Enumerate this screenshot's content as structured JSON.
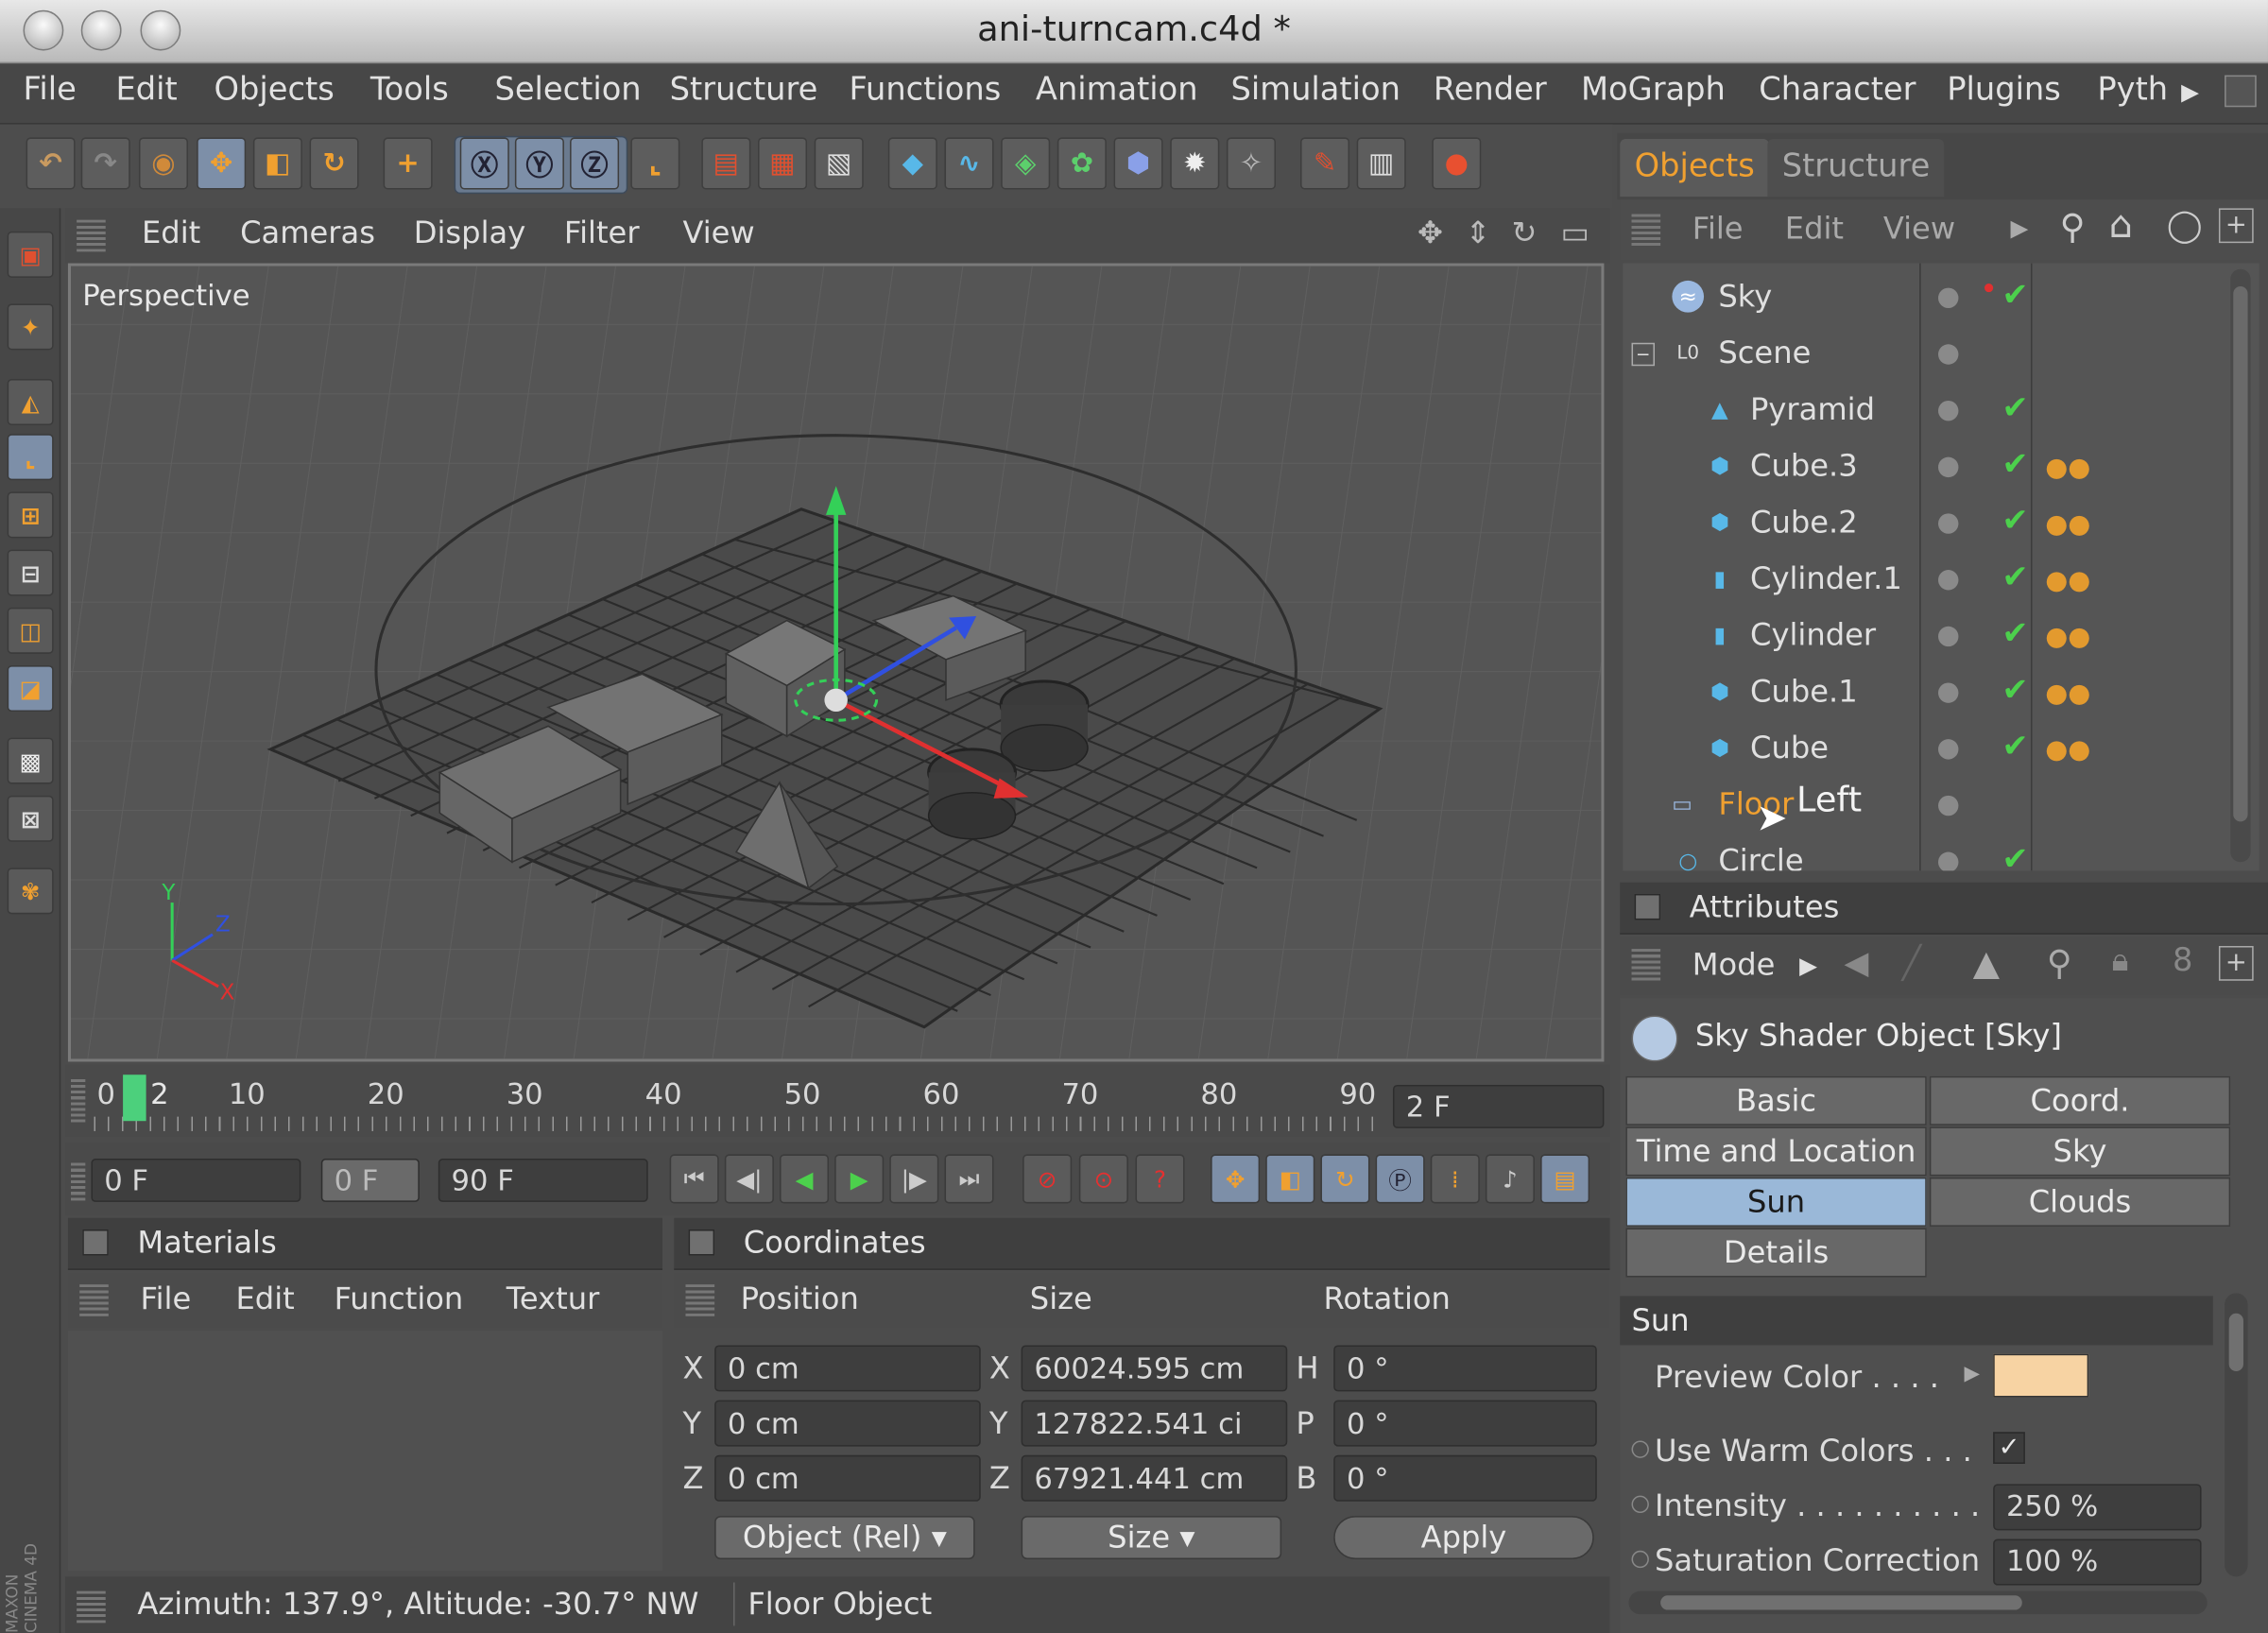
{
  "window": {
    "title": "ani-turncam.c4d *"
  },
  "menubar": {
    "items": [
      "File",
      "Edit",
      "Objects",
      "Tools",
      "Selection",
      "Structure",
      "Functions",
      "Animation",
      "Simulation",
      "Render",
      "MoGraph",
      "Character",
      "Plugins",
      "Pyth"
    ]
  },
  "viewport": {
    "menu": [
      "Edit",
      "Cameras",
      "Display",
      "Filter",
      "View"
    ],
    "label": "Perspective",
    "axis": {
      "y": "Y",
      "z": "Z",
      "x": "X"
    }
  },
  "timeline": {
    "ticks": [
      "0",
      "10",
      "20",
      "30",
      "40",
      "50",
      "60",
      "70",
      "80",
      "90"
    ],
    "current_marker": "2",
    "frame_field": "2 F"
  },
  "transport": {
    "start": "0 F",
    "min": "0 F",
    "end": "90 F"
  },
  "materials": {
    "title": "Materials",
    "menu": [
      "File",
      "Edit",
      "Function",
      "Textur"
    ]
  },
  "coordinates": {
    "title": "Coordinates",
    "headers": [
      "Position",
      "Size",
      "Rotation"
    ],
    "rows": [
      {
        "pl": "X",
        "pos": "0 cm",
        "sl": "X",
        "size": "60024.595 cm",
        "rl": "H",
        "rot": "0 °"
      },
      {
        "pl": "Y",
        "pos": "0 cm",
        "sl": "Y",
        "size": "127822.541 ci",
        "rl": "P",
        "rot": "0 °"
      },
      {
        "pl": "Z",
        "pos": "0 cm",
        "sl": "Z",
        "size": "67921.441 cm",
        "rl": "B",
        "rot": "0 °"
      }
    ],
    "mode_select": "Object (Rel)",
    "size_select": "Size",
    "apply_label": "Apply"
  },
  "status": {
    "left": "Azimuth: 137.9°, Altitude: -30.7°  NW",
    "right": "Floor Object"
  },
  "objects_panel": {
    "tabs": [
      "Objects",
      "Structure"
    ],
    "menu": [
      "File",
      "Edit",
      "View"
    ],
    "items": [
      {
        "name": "Sky",
        "icon": "sky-icon",
        "indent": 0,
        "check": true
      },
      {
        "name": "Scene",
        "icon": "null-icon",
        "indent": 0,
        "check": false
      },
      {
        "name": "Pyramid",
        "icon": "pyramid-icon",
        "indent": 1,
        "check": true
      },
      {
        "name": "Cube.3",
        "icon": "cube-icon",
        "indent": 1,
        "check": true
      },
      {
        "name": "Cube.2",
        "icon": "cube-icon",
        "indent": 1,
        "check": true
      },
      {
        "name": "Cylinder.1",
        "icon": "cylinder-icon",
        "indent": 1,
        "check": true
      },
      {
        "name": "Cylinder",
        "icon": "cylinder-icon",
        "indent": 1,
        "check": true
      },
      {
        "name": "Cube.1",
        "icon": "cube-icon",
        "indent": 1,
        "check": true
      },
      {
        "name": "Cube",
        "icon": "cube-icon",
        "indent": 1,
        "check": true
      },
      {
        "name": "Floor",
        "icon": "floor-icon",
        "indent": 0,
        "check": false
      },
      {
        "name": "Circle",
        "icon": "circle-icon",
        "indent": 0,
        "check": true
      }
    ],
    "floor_overlay": "Left"
  },
  "attributes": {
    "title": "Attributes",
    "mode_label": "Mode",
    "object_label": "Sky Shader Object [Sky]",
    "tabs": [
      "Basic",
      "Coord.",
      "Time and Location",
      "Sky",
      "Sun",
      "Clouds",
      "Details"
    ],
    "active_tab": "Sun",
    "section": "Sun",
    "preview_color_label": "Preview Color . . . .",
    "preview_color": "#f7d3a3",
    "warm_label": "Use Warm Colors . . .",
    "intensity_label": "Intensity . . . . . . . . . .",
    "intensity_value": "250 %",
    "saturation_label": "Saturation Correction",
    "saturation_value": "100 %"
  },
  "colors": {
    "accent": "#f0a030",
    "highlight": "#9ab8d8",
    "check": "#4cd04c"
  }
}
